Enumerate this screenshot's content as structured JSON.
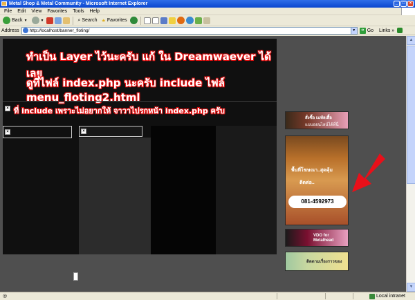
{
  "window": {
    "title": "Metal Shop & Metal Community - Microsoft Internet Explorer"
  },
  "menu": [
    "File",
    "Edit",
    "View",
    "Favorites",
    "Tools",
    "Help"
  ],
  "toolbar": {
    "back": "Back",
    "search": "Search",
    "favorites": "Favorites"
  },
  "address": {
    "label": "Address",
    "url": "http://localhost/banner_floting/",
    "go": "Go",
    "links": "Links"
  },
  "page": {
    "heading_line1": "ทำเป็น Layer ไว้นะครับ แก้ ใน Dreamwaever ได้เลย",
    "heading_line2": "ดูที่ไฟล์ index.php นะครับ include ไฟล์ menu_floting2.html",
    "heading_line3": "ที่ include เพราะไม่อยากให้ จาวาไปรกหน้า index.php ครับ",
    "close_glyph": "×"
  },
  "ads": {
    "shop_text": "สั่งซื้อ เมทัลเสื้อ",
    "shop_sub": "แบบออนไลน์ได้ที่นี่",
    "big_text1": "พื้นที่โฆษณา..สุดคุ้ม",
    "big_text2": "ติดต่อ..",
    "phone": "081-4592973",
    "vdo_text": "VDO for Metalhead",
    "pig_text": "ติดตามเรื่องราวของ"
  },
  "status": {
    "zone": "Local intranet"
  },
  "colors": {
    "page_bg": "#4f4f4f",
    "layer_bg": "#101010",
    "text_outline": "#e01010",
    "arrow": "#e8101a"
  }
}
